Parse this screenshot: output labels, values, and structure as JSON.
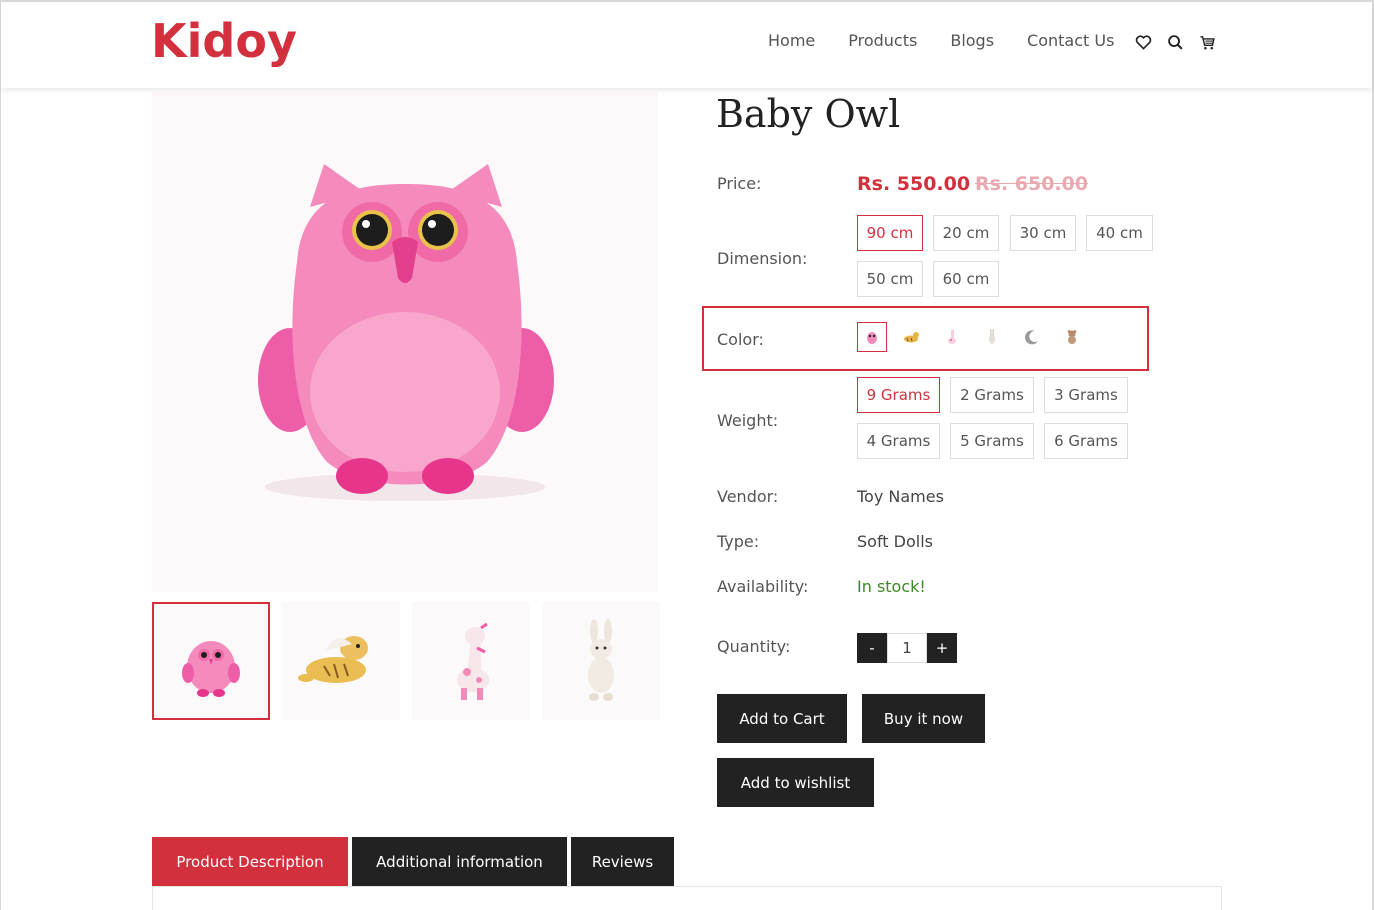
{
  "brand": {
    "logo_text": "Kidoy",
    "accent_color": "#d3303d"
  },
  "nav": {
    "items": [
      "Home",
      "Products",
      "Blogs",
      "Contact Us"
    ],
    "icons": [
      "heart-icon",
      "search-icon",
      "cart-icon"
    ]
  },
  "gallery": {
    "main_image": "pink owl plush toy",
    "thumbnails": [
      "pink owl plush",
      "winged tiger plush",
      "pink giraffe plush",
      "white bunny plush"
    ]
  },
  "product": {
    "title": "Baby Owl",
    "price_label": "Price:",
    "price": "Rs. 550.00",
    "compare_price": "Rs. 650.00",
    "dimension_label": "Dimension:",
    "dimensions": [
      "90 cm",
      "20 cm",
      "30 cm",
      "40 cm",
      "50 cm",
      "60 cm"
    ],
    "dimension_selected": "90 cm",
    "color_label": "Color:",
    "colors": [
      "owl",
      "tiger",
      "giraffe",
      "bunny",
      "moon",
      "bear"
    ],
    "color_selected": "owl",
    "weight_label": "Weight:",
    "weights": [
      "9 Grams",
      "2 Grams",
      "3 Grams",
      "4 Grams",
      "5 Grams",
      "6 Grams"
    ],
    "weight_selected": "9 Grams",
    "vendor_label": "Vendor:",
    "vendor": "Toy Names",
    "type_label": "Type:",
    "type": "Soft Dolls",
    "availability_label": "Availability:",
    "availability": "In stock!",
    "quantity_label": "Quantity:",
    "quantity": "1",
    "minus": "-",
    "plus": "+"
  },
  "actions": {
    "add_to_cart": "Add to Cart",
    "buy_now": "Buy it now",
    "add_to_wishlist": "Add to wishlist"
  },
  "tabs": [
    "Product Description",
    "Additional information",
    "Reviews"
  ],
  "active_tab": "Product Description"
}
